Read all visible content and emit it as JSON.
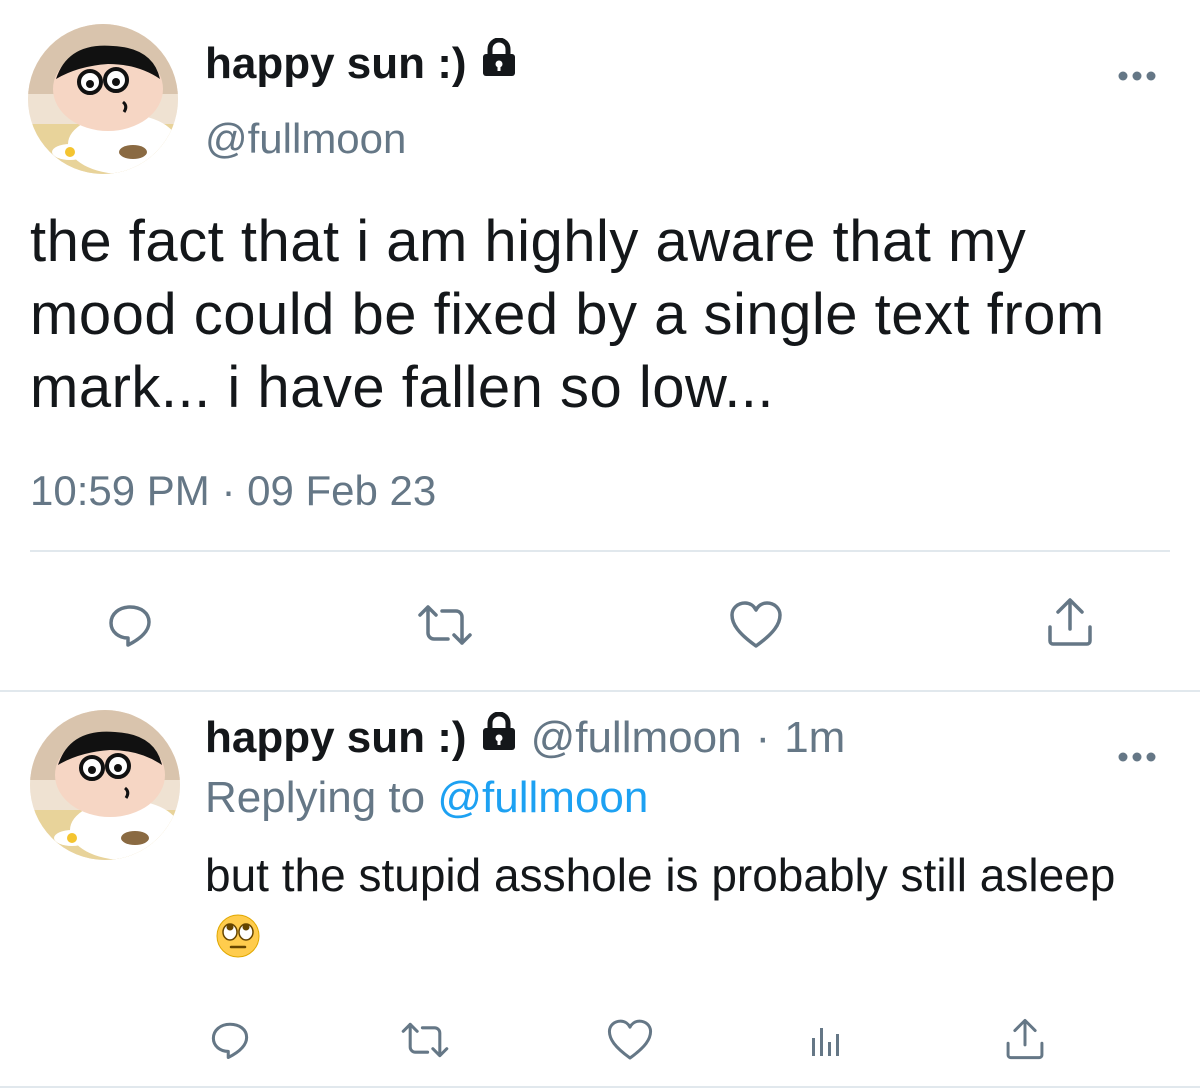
{
  "main_tweet": {
    "display_name": "happy sun :)",
    "handle": "@fullmoon",
    "text": "the fact that i am highly aware that my mood could be fixed by a single text from mark... i have fallen so low...",
    "time": "10:59 PM",
    "separator": "·",
    "date": "09 Feb 23"
  },
  "reply_tweet": {
    "display_name": "happy sun :)",
    "handle": "@fullmoon",
    "separator": "·",
    "age": "1m",
    "replying_prefix": "Replying to",
    "replying_to": "@fullmoon",
    "text": "but the stupid asshole is probably still asleep",
    "emoji": "face-with-rolling-eyes"
  },
  "icons": {
    "lock": "lock-icon",
    "more": "more-icon",
    "reply": "reply-icon",
    "retweet": "retweet-icon",
    "like": "heart-icon",
    "analytics": "analytics-icon",
    "share": "share-icon"
  },
  "colors": {
    "primary_text": "#14171a",
    "secondary_text": "#657786",
    "link": "#1da1f2",
    "divider": "#e1e8ed",
    "icon": "#657786"
  }
}
